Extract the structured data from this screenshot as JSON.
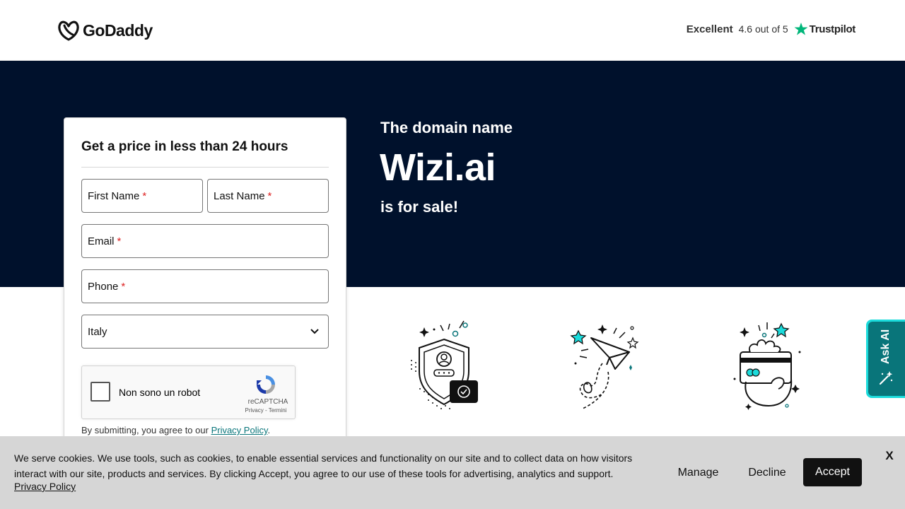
{
  "header": {
    "logo_text": "GoDaddy",
    "trust_rating_label": "Excellent",
    "trust_score": "4.6 out of 5",
    "trust_brand": "Trustpilot"
  },
  "hero": {
    "subtitle": "The domain name",
    "domain": "Wizi.ai",
    "for_sale": "is for sale!"
  },
  "form": {
    "title": "Get a price in less than 24 hours",
    "first_name": "First Name",
    "last_name": "Last Name",
    "email": "Email",
    "phone": "Phone",
    "country": "Italy",
    "required_mark": "*",
    "captcha_label": "Non sono un robot",
    "captcha_brand": "reCAPTCHA",
    "captcha_links": "Privacy - Termini",
    "terms_prefix": "By submitting, you agree to our",
    "terms_link": "Privacy Policy",
    "terms_suffix": "."
  },
  "feature_icons": [
    "shield-user-icon",
    "paper-plane-icon",
    "payment-card-icon"
  ],
  "ask_ai": {
    "label": "Ask AI",
    "icon": "magic-wand-icon"
  },
  "cookie": {
    "text": "We serve cookies. We use tools, such as cookies, to enable essential services and functionality on our site and to collect data on how visitors interact with our site, products and services. By clicking Accept, you agree to our use of these tools for advertising, analytics and support.",
    "policy_link": "Privacy Policy",
    "manage": "Manage",
    "decline": "Decline",
    "accept": "Accept",
    "close": "X"
  },
  "colors": {
    "hero_bg": "#00112c",
    "accent_teal": "#09757a",
    "trustpilot_green": "#00b67a",
    "cookie_bg": "#d6d6d6"
  }
}
